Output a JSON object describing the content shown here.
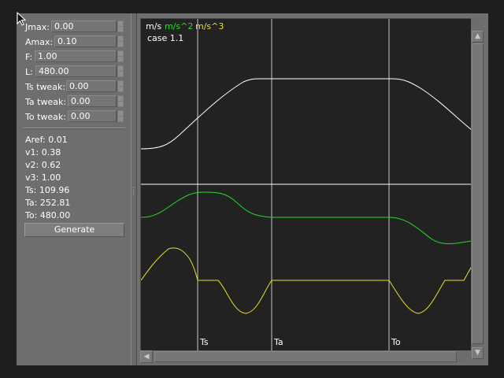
{
  "params": [
    {
      "label": "Jmax:",
      "value": "0.00"
    },
    {
      "label": "Amax:",
      "value": "0.10"
    },
    {
      "label": "F:",
      "value": "1.00"
    },
    {
      "label": "L:",
      "value": "480.00"
    },
    {
      "label": "Ts tweak:",
      "value": "0.00"
    },
    {
      "label": "Ta tweak:",
      "value": "0.00"
    },
    {
      "label": "To tweak:",
      "value": "0.00"
    }
  ],
  "results": [
    "Aref: 0.01",
    "v1: 0.38",
    "v2: 0.62",
    "v3: 1.00",
    "Ts: 109.96",
    "Ta: 252.81",
    "To: 480.00"
  ],
  "generate_label": "Generate",
  "plot": {
    "legend": [
      {
        "text": "m/s",
        "color": "#ffffff"
      },
      {
        "text": "m/s^2",
        "color": "#22dd22"
      },
      {
        "text": "m/s^3",
        "color": "#e8e020"
      }
    ],
    "case_label": "case 1.1",
    "time_markers": [
      {
        "label": "Ts"
      },
      {
        "label": "Ta"
      },
      {
        "label": "To"
      }
    ],
    "colors": {
      "velocity": "#ffffff",
      "acceleration": "#22dd22",
      "jerk": "#e8e020",
      "background": "#222222"
    }
  },
  "scroll_icons": {
    "up": "arrow-up-icon",
    "down": "arrow-down-icon",
    "left": "arrow-left-icon"
  }
}
